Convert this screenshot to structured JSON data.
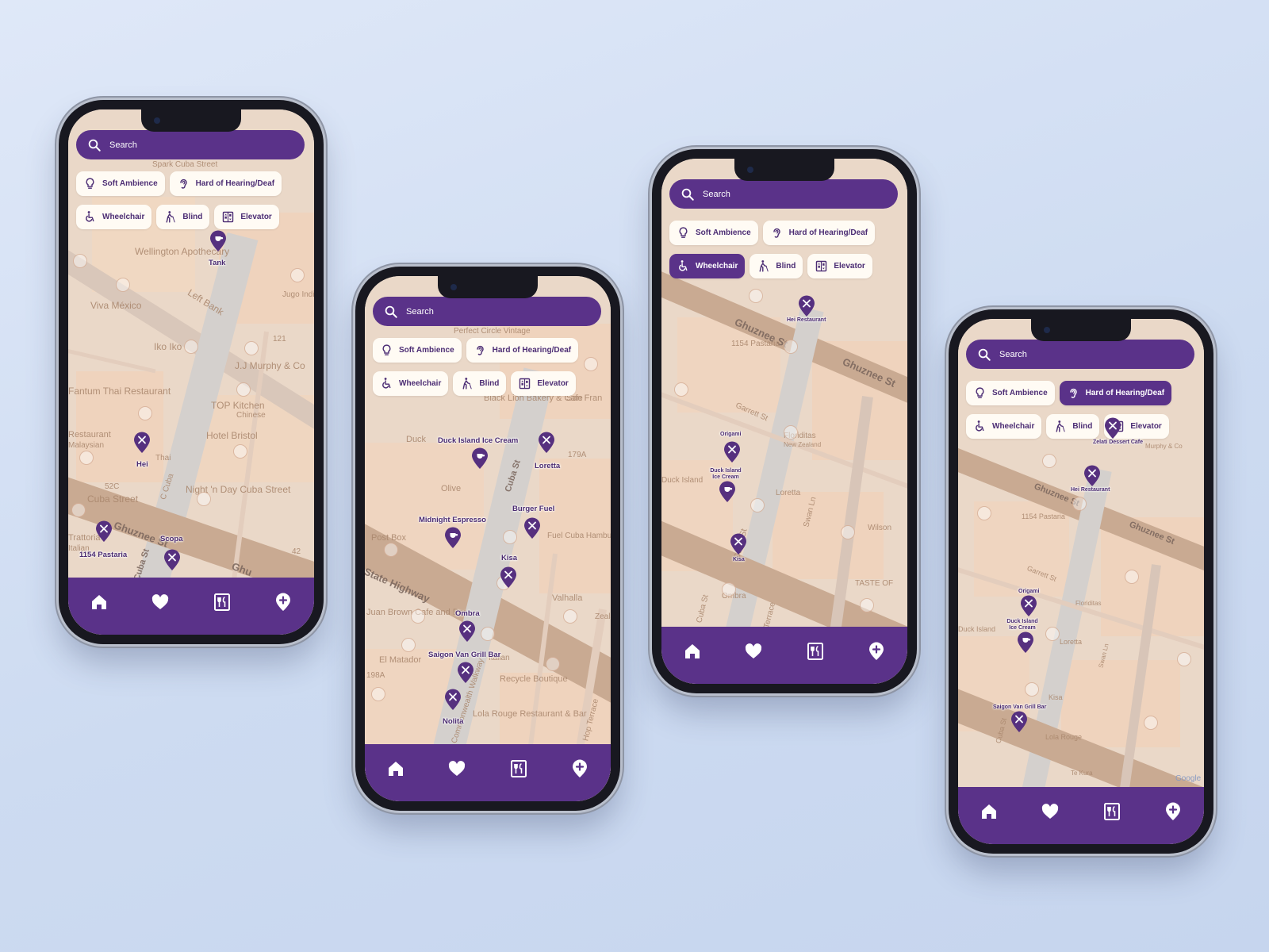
{
  "search": {
    "placeholder": "Search"
  },
  "filters": {
    "soft_ambience": "Soft Ambience",
    "hearing": "Hard of Hearing/Deaf",
    "wheelchair": "Wheelchair",
    "blind": "Blind",
    "elevator": "Elevator"
  },
  "nav": [
    "home-icon",
    "heart-icon",
    "menu-card-icon",
    "add-location-icon"
  ],
  "colors": {
    "accent": "#5a3289",
    "chip": "#fffbf4",
    "map": "#ead8c8"
  },
  "phones": [
    {
      "active_filter": "",
      "streets": [
        "Spark Cuba Street",
        "Wellington Apothecary",
        "Viva México",
        "Left Bank",
        "Iko Iko",
        "J.J Murphy & Co",
        "121",
        "Jugo Indian",
        "Fantum Thai Restaurant",
        "TOP Kitchen",
        "Chinese",
        "Hotel Bristol",
        "Restaurant",
        "Malaysian",
        "Night 'n Day Cuba Street",
        "52C",
        "Cuba Street",
        "Ghuznee St",
        "Cuba St",
        "C Cuba",
        "42",
        "Thai",
        "Trattoria",
        "Italian",
        "Ghu"
      ],
      "pins": [
        "Tank",
        "Hei",
        "1154 Pastaria",
        "Scopa"
      ]
    },
    {
      "active_filter": "",
      "streets": [
        "Perfect Circle Vintage",
        "Black Lion Bakery & Cafe",
        "San Fran",
        "Duck",
        "179A",
        "Olive",
        "Post Box",
        "State Highway",
        "Cuba St",
        "Commonwealth Walkway",
        "Juan Brown Cafe and Bar",
        "El Matador",
        "198A",
        "Recycle Boutique",
        "Lola Rouge Restaurant & Bar",
        "Valhalla",
        "Hop Terrace",
        "Fuel Cuba Hamburger",
        "Italian",
        "Zealand"
      ],
      "pins": [
        "Duck Island Ice Cream",
        "Loretta",
        "Midnight Espresso",
        "Burger Fuel",
        "Kisa",
        "Ombra",
        "Saigon Van Grill Bar",
        "Nolita"
      ]
    },
    {
      "active_filter": "wheelchair",
      "streets": [
        "Cuba St",
        "Ghuznee St",
        "1154 Pastaria",
        "Garrett St",
        "Origami",
        "Floriditas",
        "New Zealand",
        "Loretta",
        "Duck Island",
        "Swan Ln",
        "Wilson",
        "Cuba St",
        "TASTE OF",
        "Ombra",
        "Cuba St",
        "Terrace"
      ],
      "pins": [
        "Hei Restaurant",
        "Origami",
        "Duck Island Ice Cream",
        "Kisa"
      ]
    },
    {
      "active_filter": "hearing",
      "streets": [
        "Zelati Dessert Cafe",
        "Murphy & Co",
        "Ghuznee St",
        "1154 Pastaria",
        "Garrett St",
        "Floriditas",
        "Loretta",
        "Duck Island",
        "Swan Ln",
        "Kisa",
        "Lola Rouge",
        "Te Kura",
        "Cuba St",
        "Google"
      ],
      "pins": [
        "Zelati Dessert Cafe",
        "Hei Restaurant",
        "Origami",
        "Duck Island Ice Cream",
        "Saigon Van Grill Bar"
      ]
    }
  ]
}
